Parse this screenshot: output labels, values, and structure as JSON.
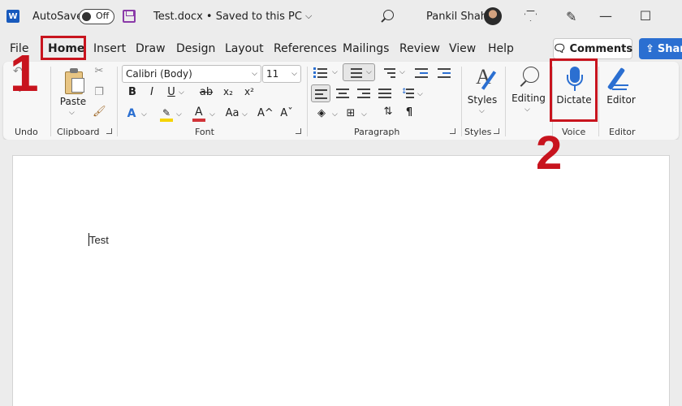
{
  "titlebar": {
    "app_letter": "W",
    "autosave_label": "AutoSave",
    "autosave_state": "Off",
    "doc_title": "Test.docx • Saved to this PC",
    "title_chevron": "⌵",
    "user_name": "Pankil Shah",
    "minimize": "—",
    "maximize": "☐"
  },
  "tabs": [
    {
      "label": "File"
    },
    {
      "label": "Home"
    },
    {
      "label": "Insert"
    },
    {
      "label": "Draw"
    },
    {
      "label": "Design"
    },
    {
      "label": "Layout"
    },
    {
      "label": "References"
    },
    {
      "label": "Mailings"
    },
    {
      "label": "Review"
    },
    {
      "label": "View"
    },
    {
      "label": "Help"
    }
  ],
  "header_buttons": {
    "comments_icon": "🗨",
    "comments": "Comments",
    "share": "Shar",
    "share_icon": "⇪"
  },
  "ribbon": {
    "undo": {
      "group": "Undo"
    },
    "clipboard": {
      "group": "Clipboard",
      "paste": "Paste"
    },
    "font": {
      "group": "Font",
      "font_name": "Calibri (Body)",
      "font_size": "11",
      "bold": "B",
      "italic": "I",
      "underline": "U",
      "strike": "ab",
      "subscript": "x₂",
      "superscript": "x²",
      "text_effects": "A",
      "font_color": "A",
      "change_case": "Aa",
      "grow": "A^",
      "shrink": "Aˇ",
      "highlight_color": "#f5d300",
      "font_color_bar": "#d13438"
    },
    "paragraph": {
      "group": "Paragraph",
      "pilcrow": "¶"
    },
    "styles": {
      "group": "Styles",
      "label": "Styles"
    },
    "editing": {
      "label": "Editing"
    },
    "voice": {
      "group": "Voice",
      "dictate": "Dictate"
    },
    "editor": {
      "group": "Editor",
      "label": "Editor"
    }
  },
  "document": {
    "body_text": "Test"
  },
  "annotations": {
    "step1": "1",
    "step2": "2",
    "highlight_color": "#c8141e"
  }
}
